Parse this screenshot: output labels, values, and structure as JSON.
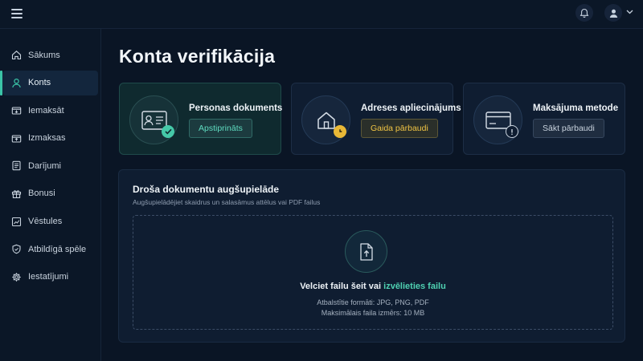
{
  "header": {
    "menu_icon": "hamburger-menu-icon",
    "notifications_icon": "bell-icon",
    "account_icon": "user-avatar-icon",
    "account_menu_icon": "chevron-down-icon"
  },
  "sidebar": {
    "items": [
      {
        "label": "Sākums",
        "icon": "home-icon",
        "active": false
      },
      {
        "label": "Konts",
        "icon": "user-icon",
        "active": true
      },
      {
        "label": "Iemaksāt",
        "icon": "wallet-in-icon",
        "active": false
      },
      {
        "label": "Izmaksas",
        "icon": "wallet-out-icon",
        "active": false
      },
      {
        "label": "Darījumi",
        "icon": "list-icon",
        "active": false
      },
      {
        "label": "Bonusi",
        "icon": "gift-icon",
        "active": false
      },
      {
        "label": "Vēstules",
        "icon": "chart-mail-icon",
        "active": false
      },
      {
        "label": "Atbildīgā spēle",
        "icon": "shield-icon",
        "active": false
      },
      {
        "label": "Iestatījumi",
        "icon": "gear-icon",
        "active": false
      }
    ]
  },
  "main": {
    "title": "Konta verifikācija",
    "cards": [
      {
        "title": "Personas dokuments",
        "status": "Apstiprināts",
        "status_type": "approved",
        "icon": "id-card-icon",
        "badge_icon": "check-icon"
      },
      {
        "title": "Adreses apliecinājums",
        "status": "Gaida pārbaudi",
        "status_type": "pending",
        "icon": "house-icon",
        "badge_icon": "clock-icon"
      },
      {
        "title": "Maksājuma metode",
        "status": "Sākt pārbaudi",
        "status_type": "start",
        "icon": "credit-card-icon",
        "badge_icon": "info-icon"
      }
    ],
    "upload": {
      "title": "Droša dokumentu augšupielāde",
      "subtitle": "Augšupielādējiet skaidrus un salasāmus attēlus vai PDF failus",
      "icon": "file-upload-icon",
      "drop_text": "Velciet failu šeit vai",
      "choose_link": "izvēlieties failu",
      "formats": "Atbalstītie formāti: JPG, PNG, PDF",
      "max_size": "Maksimālais faila izmērs: 10 MB"
    }
  },
  "colors": {
    "background": "#0a1525",
    "accent": "#3bc4a7",
    "pending": "#f0c444"
  }
}
